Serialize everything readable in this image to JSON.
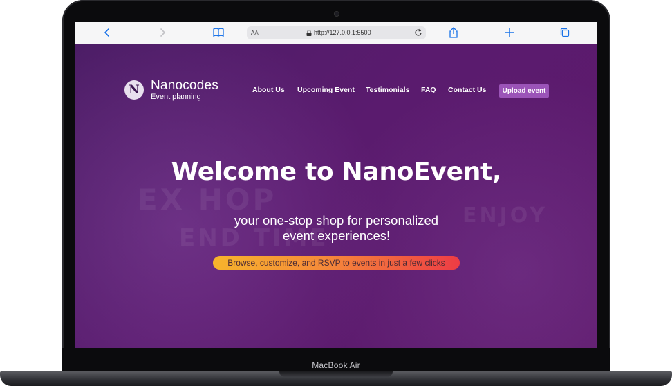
{
  "device": {
    "label": "MacBook Air"
  },
  "browser": {
    "text_size_label": "AA",
    "url": "http://127.0.0.1:5500",
    "icons": [
      "back-icon",
      "forward-icon",
      "bookmarks-icon",
      "lock-icon",
      "reload-icon",
      "share-icon",
      "new-tab-icon",
      "tabs-icon"
    ]
  },
  "site": {
    "logo": {
      "mark": "N",
      "name": "Nanocodes",
      "tagline": "Event planning"
    },
    "nav": [
      "About Us",
      "Upcoming Event",
      "Testimonials",
      "FAQ",
      "Contact Us"
    ],
    "cta_label": "Upload event",
    "hero": {
      "headline": "Welcome to NanoEvent,",
      "sub_line1": "your one-stop shop for personalized",
      "sub_line2": "event experiences!",
      "pill_text": "Browse, customize, and RSVP to events in just a few clicks"
    }
  },
  "colors": {
    "hero_bg": "#5a1b6e",
    "cta_bg": "#9b54b8",
    "pill_gradient": [
      "#f7b42c",
      "#ee3c45"
    ],
    "browser_icon": "#1a73e8"
  }
}
